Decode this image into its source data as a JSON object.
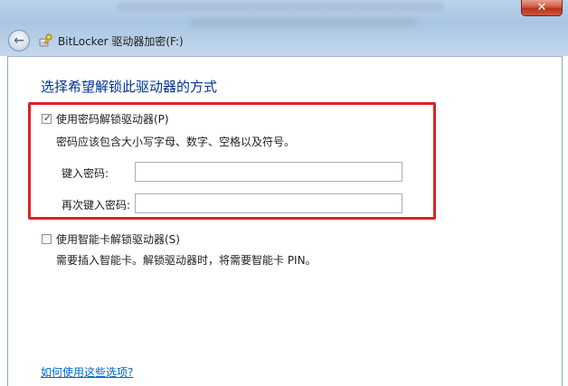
{
  "window": {
    "title": "BitLocker 驱动器加密(F:)",
    "close_glyph": "✕",
    "back_glyph": "←"
  },
  "heading": "选择希望解锁此驱动器的方式",
  "password_option": {
    "checked": true,
    "label": "使用密码解锁驱动器(P)",
    "hint": "密码应该包含大小写字母、数字、空格以及符号。",
    "enter_label": "键入密码:",
    "enter_value": "",
    "reenter_label": "再次键入密码:",
    "reenter_value": ""
  },
  "smartcard_option": {
    "checked": false,
    "label": "使用智能卡解锁驱动器(S)",
    "hint": "需要插入智能卡。解锁驱动器时，将需要智能卡 PIN。"
  },
  "help_link": "如何使用这些选项?",
  "colors": {
    "heading": "#003399",
    "highlight_border": "#e01f25",
    "link": "#0066cc"
  },
  "icons": {
    "back": "back-arrow-icon",
    "app": "bitlocker-key-icon",
    "close": "close-icon",
    "check": "checkmark-icon"
  }
}
